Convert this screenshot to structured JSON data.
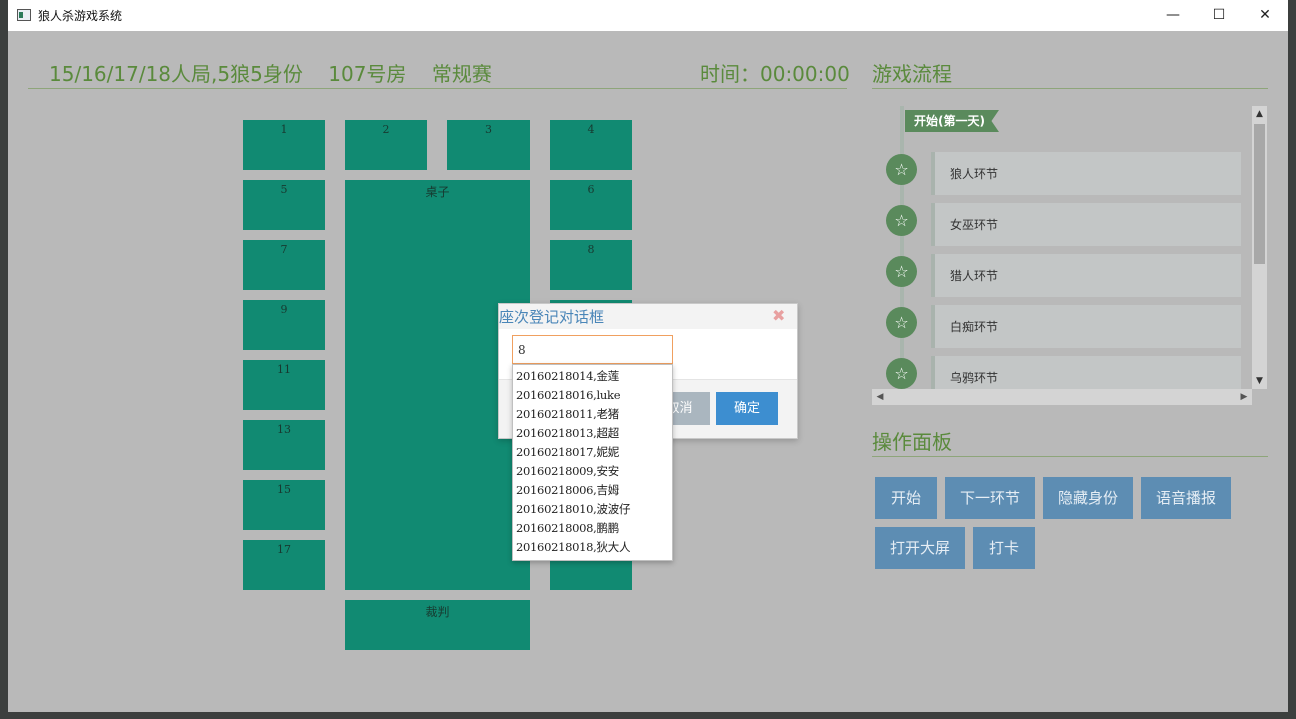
{
  "window": {
    "title": "狼人杀游戏系统",
    "minimize": "—",
    "maximize": "☐",
    "close": "✕"
  },
  "header": {
    "info": "15/16/17/18人局,5狼5身份    107号房    常规赛",
    "timer": "时间：00:00:00"
  },
  "seats": [
    "1",
    "2",
    "3",
    "4",
    "5",
    "6",
    "7",
    "8",
    "9",
    "11",
    "13",
    "15",
    "17"
  ],
  "table": {
    "label": "桌子"
  },
  "judge": {
    "label": "裁判"
  },
  "flow": {
    "title": "游戏流程",
    "start": "开始(第一天)",
    "steps": [
      "狼人环节",
      "女巫环节",
      "猎人环节",
      "白痴环节",
      "乌鸦环节"
    ],
    "star_icon": "☆"
  },
  "ops": {
    "title": "操作面板",
    "buttons": [
      "开始",
      "下一环节",
      "隐藏身份",
      "语音播报",
      "打开大屏",
      "打卡"
    ]
  },
  "dialog": {
    "title": "座次登记对话框",
    "close": "✖",
    "input_value": "8",
    "cancel": "取消",
    "ok": "确定"
  },
  "suggestions": [
    "20160218014,金莲",
    "20160218016,luke",
    "20160218011,老猪",
    "20160218013,超超",
    "20160218017,妮妮",
    "20160218009,安安",
    "20160218006,吉姆",
    "20160218010,波波仔",
    "20160218008,鹏鹏",
    "20160218018,狄大人"
  ],
  "colors": {
    "seat": "#118a72",
    "accent": "#5a8a3c",
    "button": "#5d8db3",
    "ok": "#3d8ed0"
  }
}
